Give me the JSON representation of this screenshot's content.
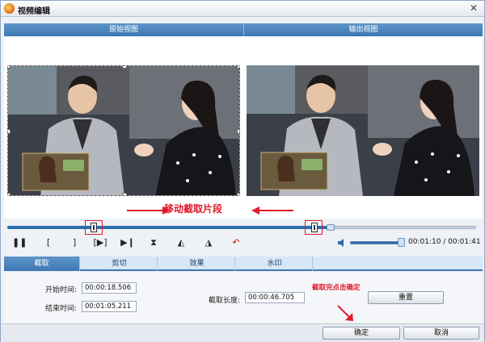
{
  "window": {
    "title": "视频编辑"
  },
  "views": {
    "original_label": "原始视图",
    "output_label": "输出视图"
  },
  "annotation": {
    "move_segment": "移动截取片段",
    "hint": "截取完点击确定"
  },
  "playback": {
    "time_display": "00:01:10 / 00:01:41",
    "progress": 0.69,
    "volume": 0.95
  },
  "tabs": [
    {
      "label": "截取"
    },
    {
      "label": "剪切"
    },
    {
      "label": "效果"
    },
    {
      "label": "水印"
    }
  ],
  "trim": {
    "start_label": "开始时间:",
    "start_value": "00:00:18.506",
    "end_label": "结束时间:",
    "end_value": "00:01:05.211",
    "length_label": "截取长度:",
    "length_value": "00:00:46.705",
    "reset_label": "重置"
  },
  "footer": {
    "ok_label": "确定",
    "cancel_label": "取消"
  },
  "colors": {
    "accent": "#3d77b3",
    "annotation": "#e0192a"
  },
  "icons": [
    "pause-icon",
    "mark-in-icon",
    "mark-out-icon",
    "next-frame-icon",
    "skip-end-icon",
    "split-icon",
    "rotate-left-icon",
    "rotate-right-icon",
    "undo-icon",
    "volume-icon"
  ]
}
